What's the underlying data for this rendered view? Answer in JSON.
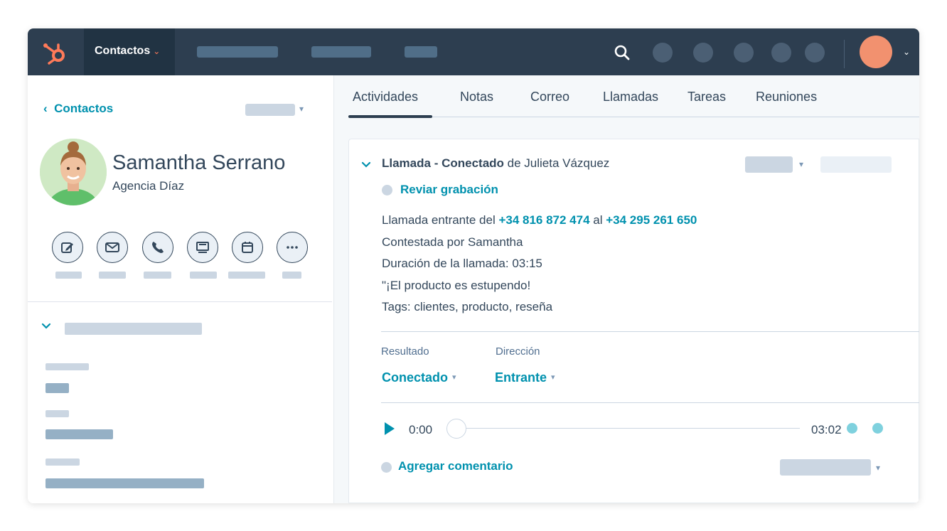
{
  "nav": {
    "active_label": "Contactos",
    "active_caret": "⌄",
    "avatar_caret": "⌄",
    "colors": {
      "bar": "#2d3e50",
      "active": "#213343",
      "logo": "#ff7a59",
      "avatar": "#f2916f"
    }
  },
  "contact": {
    "back_label": "Contactos",
    "back_chevron": "‹",
    "name": "Samantha Serrano",
    "company": "Agencia Díaz",
    "actions": [
      "edit-icon",
      "email-icon",
      "phone-icon",
      "meeting-icon",
      "calendar-icon",
      "more-icon"
    ]
  },
  "tabs": [
    {
      "label": "Actividades",
      "active": true
    },
    {
      "label": "Notas"
    },
    {
      "label": "Correo"
    },
    {
      "label": "Llamadas"
    },
    {
      "label": "Tareas"
    },
    {
      "label": "Reuniones"
    }
  ],
  "call": {
    "title_bold": "Llamada - Conectado",
    "title_rest": " de Julieta Vázquez",
    "review_label": "Reviar grabación",
    "line1_prefix": "Llamada entrante del ",
    "from_number": "+34 816 872 474",
    "line1_mid": " al ",
    "to_number": "+34 295 261 650",
    "line2": "Contestada por Samantha",
    "line3": "Duración de la llamada: 03:15",
    "line4": "\"¡El producto es estupendo!",
    "line5": "Tags: clientes, producto, reseña",
    "result_label": "Resultado",
    "result_value": "Conectado",
    "direction_label": "Dirección",
    "direction_value": "Entrante",
    "caret": "▾",
    "time_start": "0:00",
    "time_end": "03:02",
    "comment_label": "Agregar comentario",
    "accent": "#0091ae"
  }
}
